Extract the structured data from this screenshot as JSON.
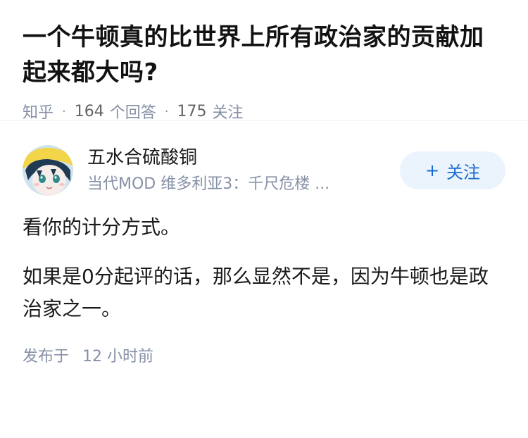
{
  "question": {
    "title": "一个牛顿真的比世界上所有政治家的贡献加起来都大吗?",
    "source": "知乎",
    "answer_count": "164",
    "answer_label": "个回答",
    "follower_count": "175",
    "follower_label": "关注"
  },
  "answer": {
    "author": {
      "name": "五水合硫酸铜",
      "headline": "当代MOD 维多利亚3：千尺危楼 ...",
      "avatar_icon": "anime-character-avatar"
    },
    "follow_button": {
      "icon": "+",
      "label": "关注"
    },
    "paragraphs": [
      "看你的计分方式。",
      "如果是0分起评的话，那么显然不是，因为牛顿也是政治家之一。"
    ],
    "published_label": "发布于",
    "published_time": "12 小时前"
  },
  "colors": {
    "accent": "#1a6bd0",
    "follow_bg": "#ebf4fc",
    "meta_gray": "#8590a6"
  }
}
